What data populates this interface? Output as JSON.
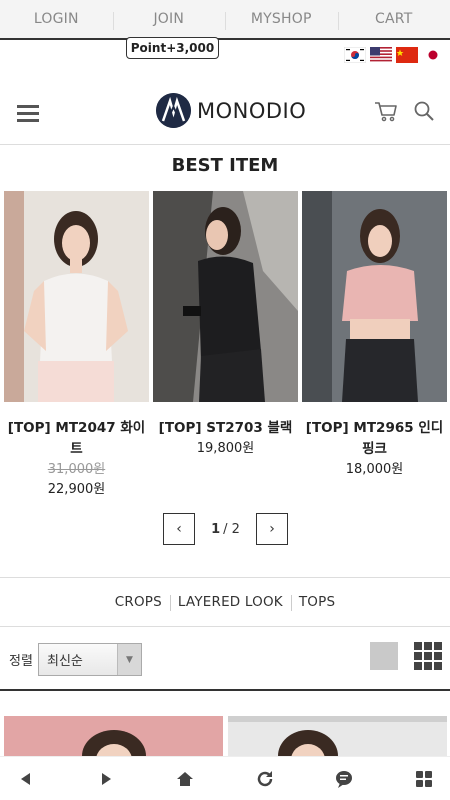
{
  "topnav": {
    "items": [
      "LOGIN",
      "JOIN",
      "MYSHOP",
      "CART"
    ],
    "point_badge": "Point+3,000"
  },
  "flags": [
    "korea-flag",
    "usa-flag",
    "china-flag",
    "japan-flag"
  ],
  "header": {
    "logo_text": "MONODIO"
  },
  "best": {
    "title": "BEST ITEM",
    "products": [
      {
        "name": "[TOP] MT2047 화이트",
        "old_price": "31,000원",
        "price": "22,900원"
      },
      {
        "name": "[TOP] ST2703 블랙",
        "old_price": "",
        "price": "19,800원"
      },
      {
        "name": "[TOP] MT2965 인디핑크",
        "old_price": "",
        "price": "18,000원"
      }
    ],
    "pager": {
      "prev": "‹",
      "next": "›",
      "current": "1",
      "total": "/ 2"
    }
  },
  "categories": [
    "CROPS",
    "LAYERED LOOK",
    "TOPS"
  ],
  "sort": {
    "label": "정렬",
    "selected": "최신순"
  },
  "colors": {
    "nav_bg": "#f4f4f4",
    "logo": "#1f2a44",
    "top_dark": "#333333"
  }
}
